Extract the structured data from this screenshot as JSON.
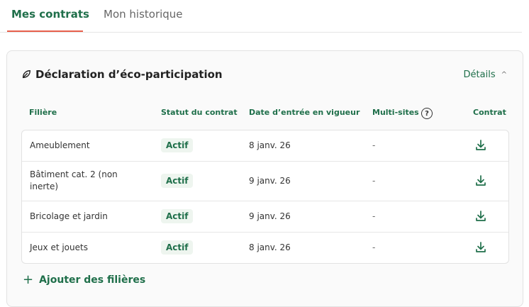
{
  "tabs": [
    {
      "label": "Mes contrats"
    },
    {
      "label": "Mon historique"
    }
  ],
  "card": {
    "title": "Déclaration d’éco-participation",
    "details_label": "Détails",
    "columns": {
      "filiere": "Filière",
      "statut": "Statut du contrat",
      "date": "Date d’entrée en vigueur",
      "multi": "Multi-sites",
      "contrat": "Contrat"
    },
    "rows": [
      {
        "filiere": "Ameublement",
        "statut": "Actif",
        "date": "8 janv. 26",
        "multi": "-"
      },
      {
        "filiere": "Bâtiment cat. 2 (non inerte)",
        "statut": "Actif",
        "date": "9 janv. 26",
        "multi": "-"
      },
      {
        "filiere": "Bricolage et jardin",
        "statut": "Actif",
        "date": "9 janv. 26",
        "multi": "-"
      },
      {
        "filiere": "Jeux et jouets",
        "statut": "Actif",
        "date": "8 janv. 26",
        "multi": "-"
      }
    ],
    "add_label": "Ajouter des filières"
  },
  "colors": {
    "accent_green": "#1f6f4a",
    "tab_underline": "#e8604c"
  }
}
